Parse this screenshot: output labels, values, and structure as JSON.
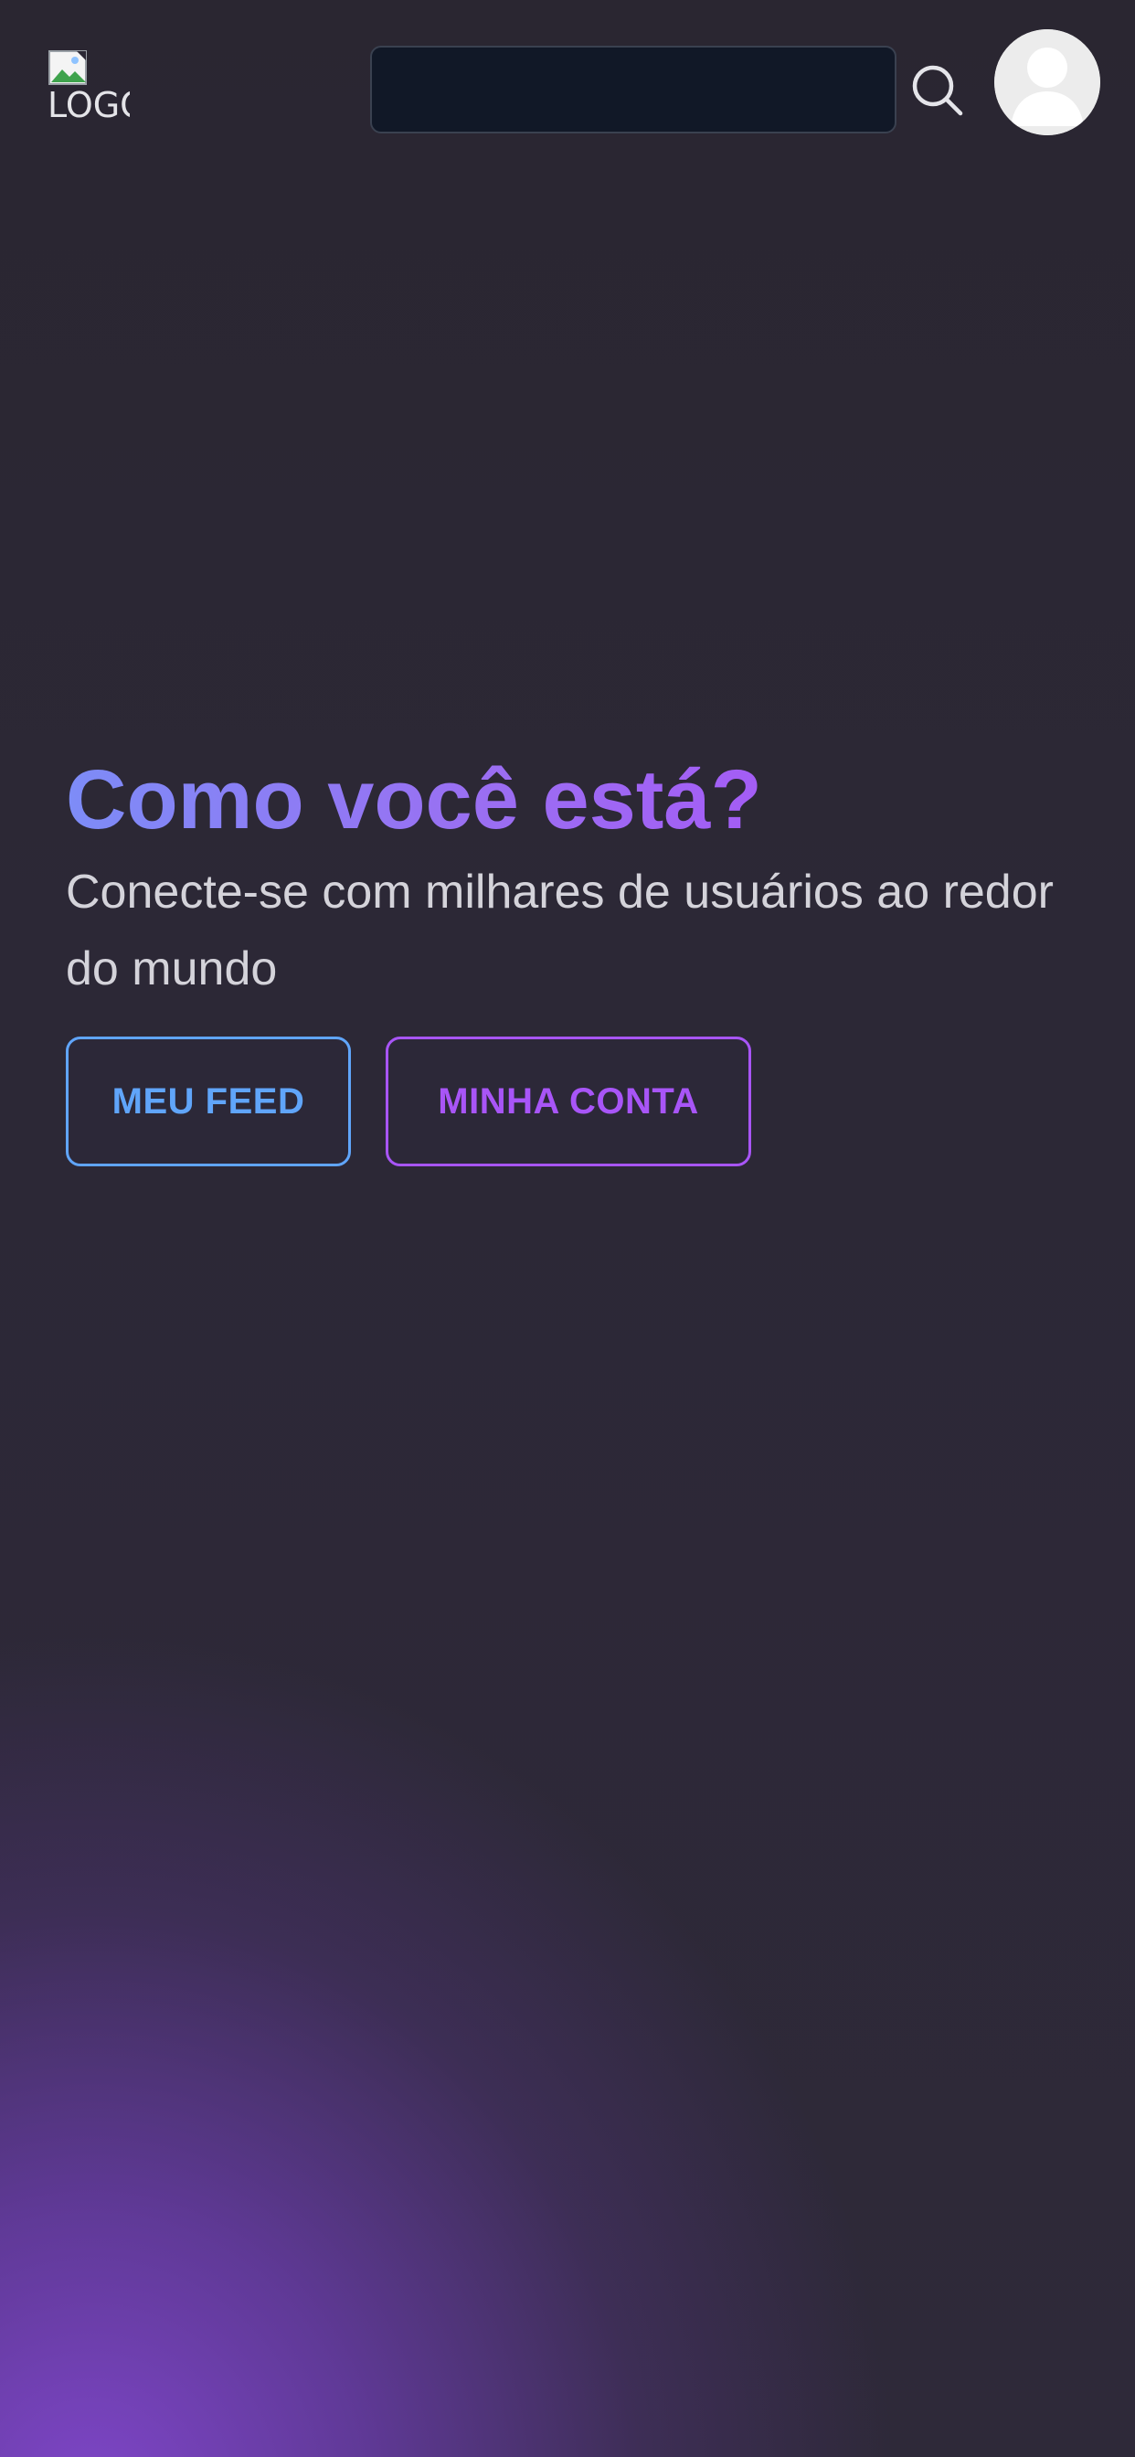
{
  "header": {
    "logo_alt": "LOGO",
    "search": {
      "value": "",
      "placeholder": ""
    },
    "icons": {
      "search": "search-icon",
      "avatar": "user-avatar-icon",
      "broken_image": "broken-image-icon"
    }
  },
  "hero": {
    "title": "Como você está?",
    "subtitle": "Conecte-se com milhares de usuários ao redor do mundo"
  },
  "actions": {
    "feed_label": "MEU FEED",
    "account_label": "MINHA CONTA"
  },
  "colors": {
    "background": "#2b2734",
    "accent_blue": "#60a5fa",
    "accent_purple": "#a855f7",
    "title_gradient_start": "#7d8cf7",
    "title_gradient_end": "#a855f7",
    "search_bg": "#111827"
  }
}
